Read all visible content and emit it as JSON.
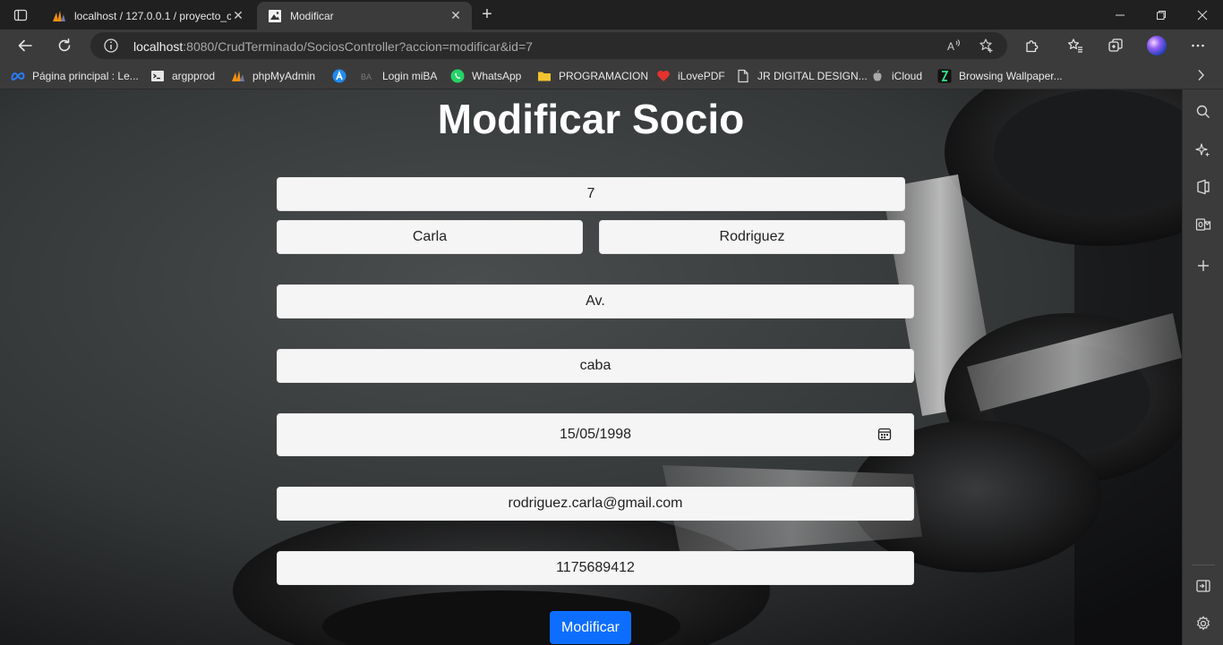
{
  "browser": {
    "tabs": [
      {
        "title": "localhost / 127.0.0.1 / proyecto_c",
        "icon": "phpmyadmin-icon",
        "active": false
      },
      {
        "title": "Modificar",
        "icon": "page-icon",
        "active": true
      }
    ],
    "address": {
      "host": "localhost",
      "path": ":8080/CrudTerminado/SociosController?accion=modificar&id=7"
    },
    "bookmarks": [
      {
        "label": "Página principal : Le...",
        "icon": "meta-icon"
      },
      {
        "label": "argpprod",
        "icon": "terminal-icon"
      },
      {
        "label": "phpMyAdmin",
        "icon": "phpmyadmin-icon"
      },
      {
        "label": "",
        "icon": "a-circle-icon"
      },
      {
        "label": "Login miBA",
        "icon": "ba-icon"
      },
      {
        "label": "WhatsApp",
        "icon": "whatsapp-icon"
      },
      {
        "label": "PROGRAMACION",
        "icon": "folder-icon"
      },
      {
        "label": "iLovePDF",
        "icon": "heart-icon"
      },
      {
        "label": "JR DIGITAL DESIGN...",
        "icon": "document-icon"
      },
      {
        "label": "iCloud",
        "icon": "apple-icon"
      },
      {
        "label": "Browsing Wallpaper...",
        "icon": "wallpaper-icon"
      }
    ]
  },
  "page": {
    "title": "Modificar Socio",
    "form": {
      "id": "7",
      "nombre": "Carla",
      "apellido": "Rodriguez",
      "direccion": "Av.",
      "localidad": "caba",
      "fecha_nacimiento": "15/05/1998",
      "email": "rodriguez.carla@gmail.com",
      "telefono": "1175689412"
    },
    "submit_label": "Modificar"
  },
  "colors": {
    "button": "#0d6efd",
    "field_bg": "#f5f5f5",
    "chrome": "#3b3b3b"
  }
}
